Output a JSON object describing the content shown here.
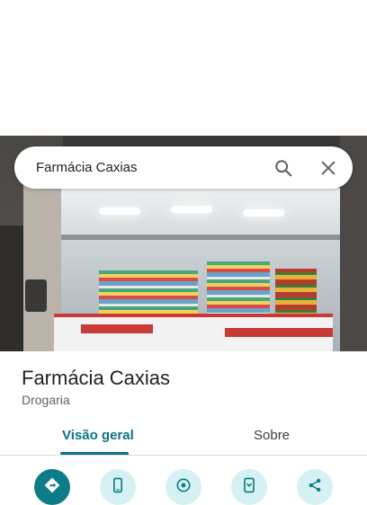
{
  "search": {
    "query": "Farmácia Caxias"
  },
  "place": {
    "name": "Farmácia Caxias",
    "category": "Drogaria"
  },
  "tabs": [
    {
      "label": "Visão geral",
      "active": true
    },
    {
      "label": "Sobre",
      "active": false
    }
  ],
  "actions": [
    {
      "icon": "directions-icon",
      "primary": true
    },
    {
      "icon": "phone-icon",
      "primary": false
    },
    {
      "icon": "location-icon",
      "primary": false
    },
    {
      "icon": "save-icon",
      "primary": false
    },
    {
      "icon": "share-icon",
      "primary": false
    }
  ],
  "colors": {
    "accent": "#0b7285",
    "action_primary": "#0e7c86",
    "action_secondary": "#d6f1f4"
  }
}
